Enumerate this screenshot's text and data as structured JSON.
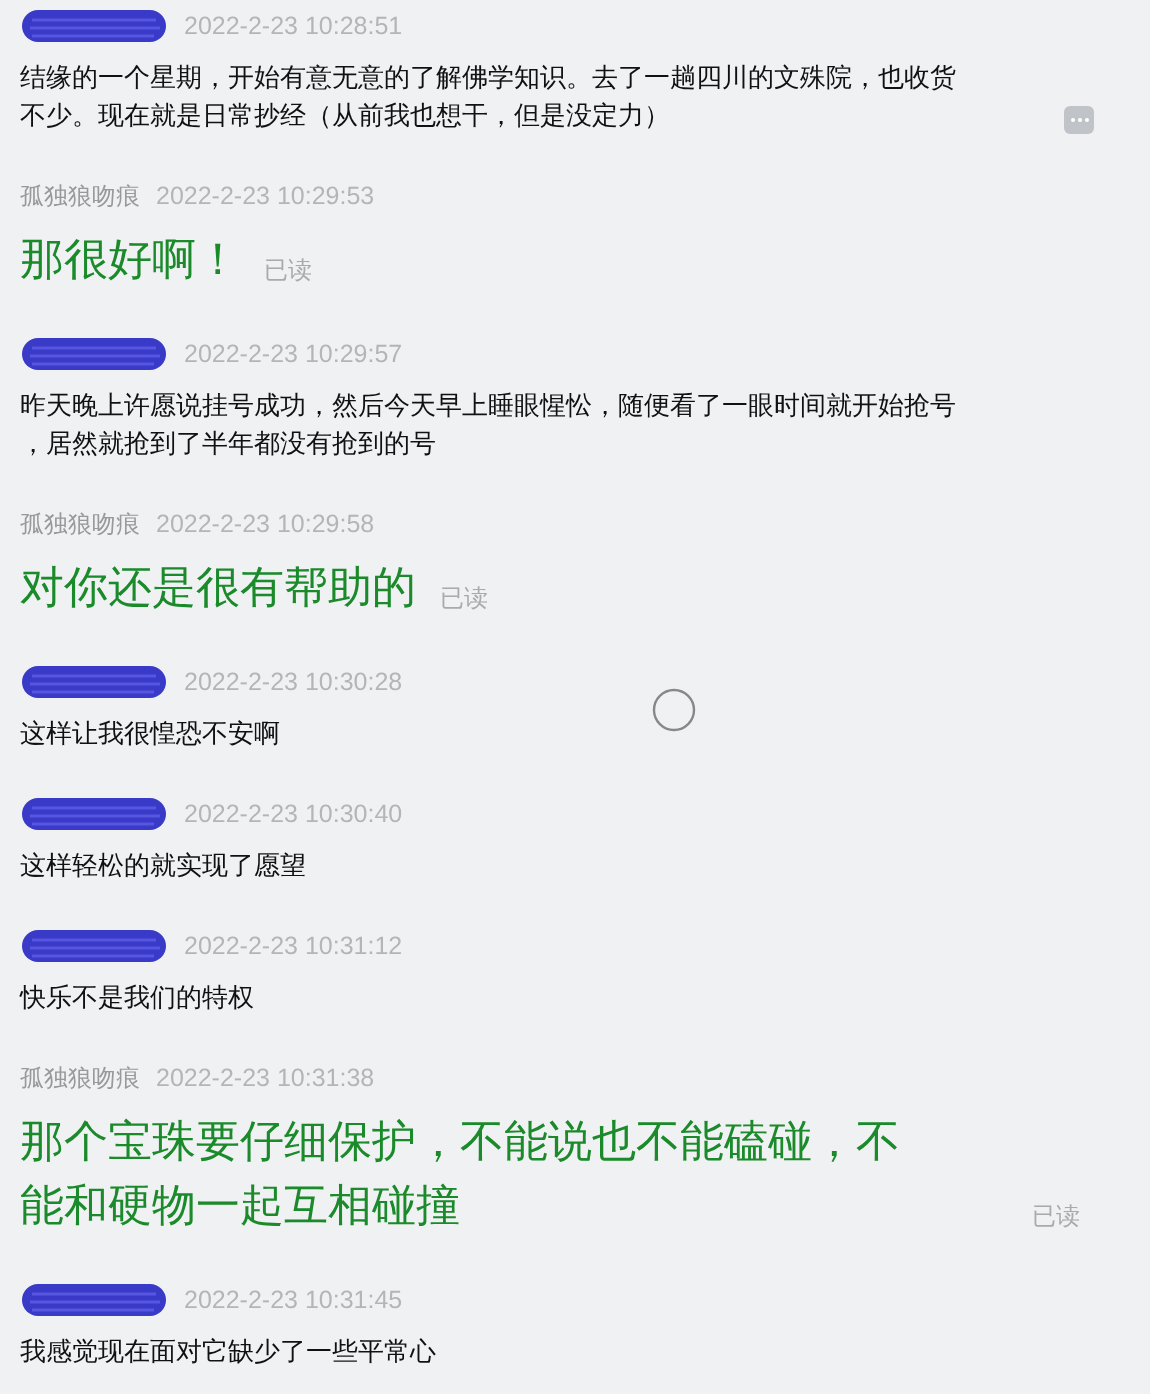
{
  "messages": [
    {
      "kind": "other",
      "time": "2022-2-23 10:28:51",
      "lines": [
        "结缘的一个星期，开始有意无意的了解佛学知识。去了一趟四川的文殊院，也收货",
        "不少。现在就是日常抄经（从前我也想干，但是没定力）"
      ],
      "more_button": true
    },
    {
      "kind": "self",
      "sender": "孤独狼吻痕",
      "time": "2022-2-23 10:29:53",
      "lines": [
        "那很好啊！"
      ],
      "receipt": "已读",
      "more_button": false
    },
    {
      "kind": "other",
      "time": "2022-2-23 10:29:57",
      "lines": [
        "昨天晚上许愿说挂号成功，然后今天早上睡眼惺忪，随便看了一眼时间就开始抢号",
        "，居然就抢到了半年都没有抢到的号"
      ],
      "more_button": false
    },
    {
      "kind": "self",
      "sender": "孤独狼吻痕",
      "time": "2022-2-23 10:29:58",
      "lines": [
        "对你还是很有帮助的"
      ],
      "receipt": "已读",
      "more_button": false
    },
    {
      "kind": "other",
      "time": "2022-2-23 10:30:28",
      "lines": [
        "这样让我很惶恐不安啊"
      ],
      "more_button": false
    },
    {
      "kind": "other",
      "time": "2022-2-23 10:30:40",
      "lines": [
        "这样轻松的就实现了愿望"
      ],
      "more_button": false
    },
    {
      "kind": "other",
      "time": "2022-2-23 10:31:12",
      "lines": [
        "快乐不是我们的特权"
      ],
      "more_button": false
    },
    {
      "kind": "self",
      "sender": "孤独狼吻痕",
      "time": "2022-2-23 10:31:38",
      "lines": [
        "那个宝珠要仔细保护，不能说也不能磕碰，不",
        "能和硬物一起互相碰撞"
      ],
      "receipt": "已读",
      "more_button": false
    },
    {
      "kind": "other",
      "time": "2022-2-23 10:31:45",
      "lines": [
        "我感觉现在面对它缺少了一些平常心"
      ],
      "more_button": false
    }
  ]
}
